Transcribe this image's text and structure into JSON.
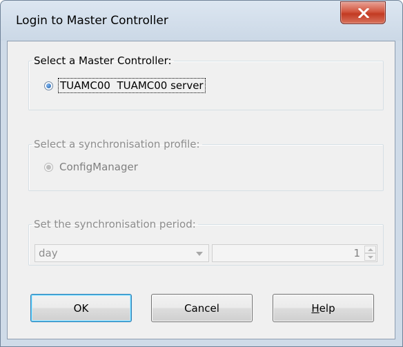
{
  "window": {
    "title": "Login to Master Controller",
    "close_icon": "close-icon"
  },
  "master_controller": {
    "group_title": "Select a Master Controller:",
    "option_label": "TUAMC00  TUAMC00 server",
    "selected": true
  },
  "sync_profile": {
    "group_title": "Select a synchronisation profile:",
    "option_label": "ConfigManager",
    "selected": true,
    "enabled": false
  },
  "sync_period": {
    "group_title": "Set the synchronisation period:",
    "unit_selected": "day",
    "value": "1",
    "enabled": false
  },
  "buttons": {
    "ok": "OK",
    "cancel": "Cancel",
    "help": "Help"
  },
  "colors": {
    "frame": "#cfdbe8",
    "client_background": "#f0f0f0",
    "close_button": "#c8452d",
    "default_button_border": "#3c7fb1"
  }
}
